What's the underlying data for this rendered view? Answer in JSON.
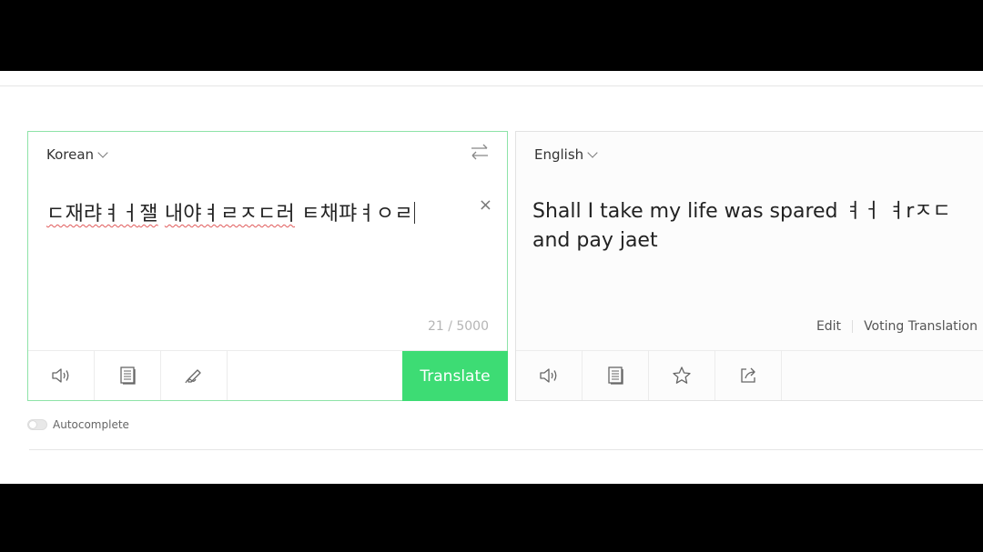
{
  "source": {
    "language": "Korean",
    "text_parts": [
      "ㄷ재랴ㅕㅓ",
      "잴",
      " ",
      "내야ㅕㄹㅈㄷ러",
      " ㅌ채퍄ㅕㅇㄹ"
    ],
    "char_count": "21 / 5000",
    "clear_label": "×",
    "translate_label": "Translate"
  },
  "target": {
    "language": "English",
    "text": "Shall I take my life was spared ㅕㅓ ㅕrㅈㄷ and pay jaet",
    "edit_label": "Edit",
    "voting_label": "Voting Translation"
  },
  "autocomplete": {
    "label": "Autocomplete",
    "enabled": false
  },
  "icons": {
    "source_tools": [
      "speaker-icon",
      "dictionary-icon",
      "handwriting-icon"
    ],
    "target_tools": [
      "speaker-icon",
      "dictionary-icon",
      "star-icon",
      "share-icon"
    ],
    "swap": "swap-icon"
  },
  "colors": {
    "accent": "#3ddc74",
    "border_active": "#8ee3a8"
  }
}
